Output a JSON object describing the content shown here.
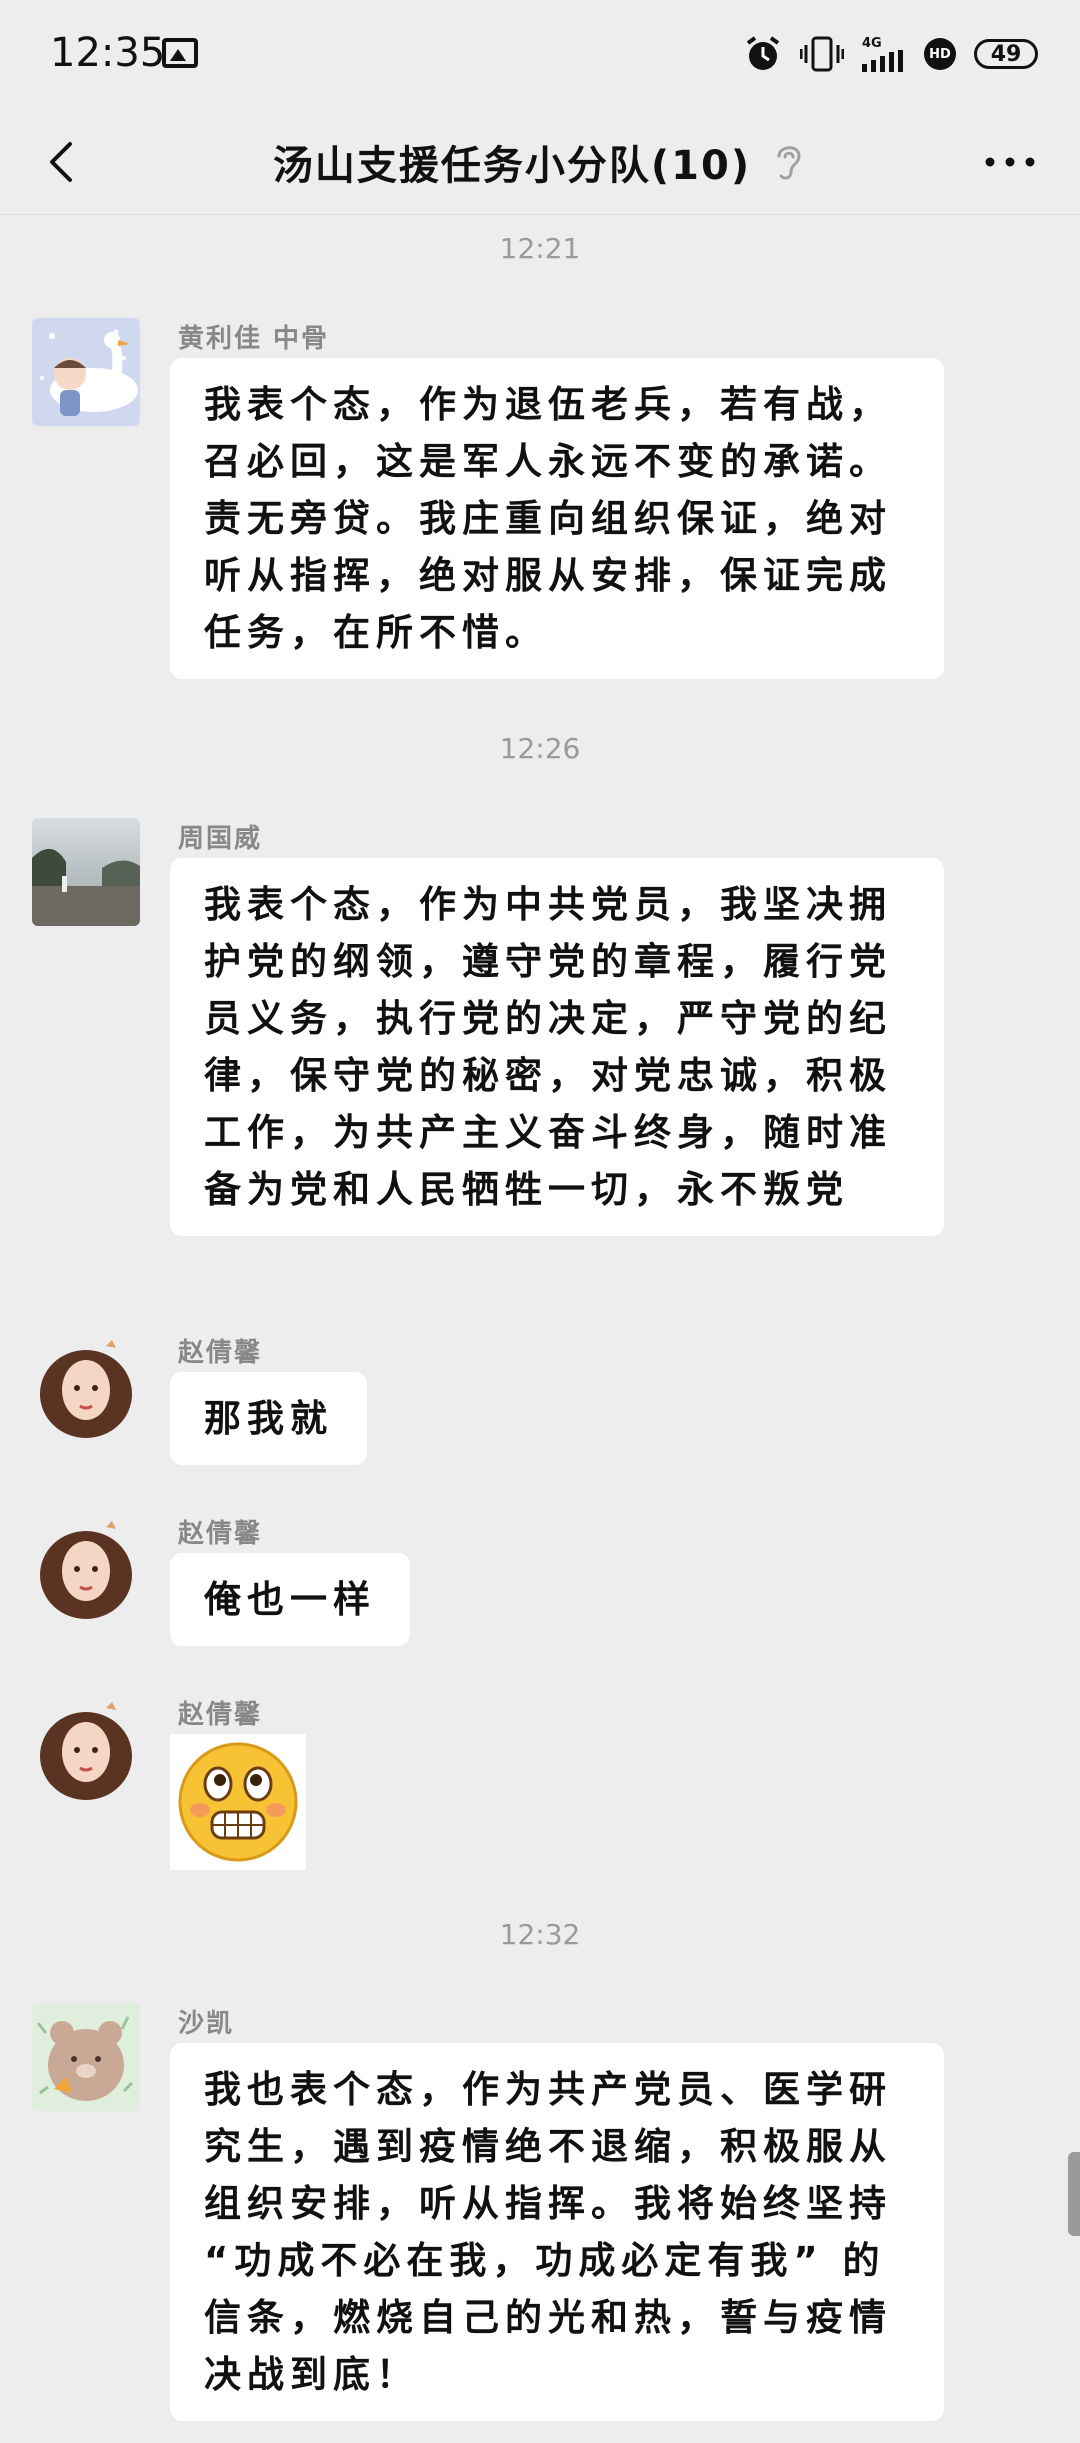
{
  "status_bar": {
    "time": "12:35",
    "signal": "4G",
    "hd": "HD",
    "battery": "49"
  },
  "header": {
    "title": "汤山支援任务小分队(10)"
  },
  "timestamps": [
    "12:21",
    "12:26",
    "12:32"
  ],
  "messages": [
    {
      "sender": "黄利佳 中骨",
      "text": "我表个态，作为退伍老兵，若有战，召必回，这是军人永远不变的承诺。责无旁贷。我庄重向组织保证，绝对听从指挥，绝对服从安排，保证完成任务，在所不惜。"
    },
    {
      "sender": "周国威",
      "text": "我表个态，作为中共党员，我坚决拥护党的纲领，遵守党的章程，履行党员义务，执行党的决定，严守党的纪律，保守党的秘密，对党忠诚，积极工作，为共产主义奋斗终身，随时准备为党和人民牺牲一切，永不叛党"
    },
    {
      "sender": "赵倩馨",
      "text": "那我就"
    },
    {
      "sender": "赵倩馨",
      "text": "俺也一样"
    },
    {
      "sender": "赵倩馨",
      "sticker": "grinning-emoji-sticker"
    },
    {
      "sender": "沙凯",
      "text": "我也表个态，作为共产党员、医学研究生，遇到疫情绝不退缩，积极服从组织安排，听从指挥。我将始终坚持 “功成不必在我，功成必定有我” 的信条，燃烧自己的光和热，誓与疫情决战到底！"
    }
  ],
  "colors": {
    "background": "#ededed",
    "bubble": "#ffffff",
    "timestamp": "#9a9a9a",
    "sender": "#888888"
  }
}
